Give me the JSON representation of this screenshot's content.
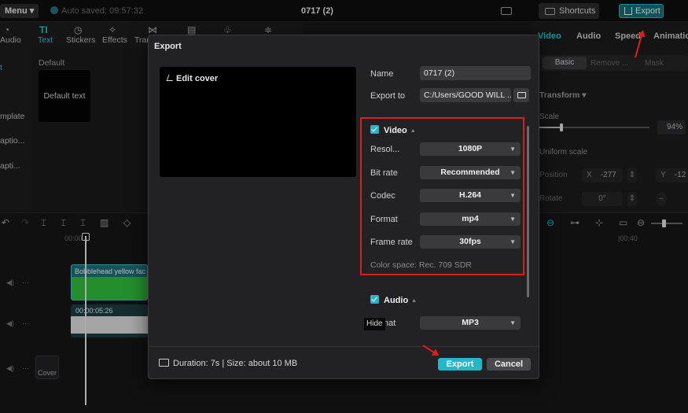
{
  "topbar": {
    "menu_label": "Menu",
    "autosave_text": "Auto saved: 09:57:32",
    "project_title": "0717 (2)",
    "shortcuts_label": "Shortcuts",
    "export_label": "Export"
  },
  "media_tabs": [
    {
      "label": "Audio"
    },
    {
      "label": "Text"
    },
    {
      "label": "Stickers"
    },
    {
      "label": "Effects"
    },
    {
      "label": "Tran"
    }
  ],
  "left_nav": [
    {
      "label": "t"
    },
    {
      "label": "mplate"
    },
    {
      "label": "aptio..."
    },
    {
      "label": "apti..."
    }
  ],
  "media_panel": {
    "section_label": "Default",
    "card_label": "Default text"
  },
  "right_panel": {
    "tabs": [
      {
        "label": "Video"
      },
      {
        "label": "Audio"
      },
      {
        "label": "Speed"
      },
      {
        "label": "Animatio"
      }
    ],
    "subtabs": [
      {
        "label": "Basic"
      },
      {
        "label": "Remove ..."
      },
      {
        "label": "Mask"
      }
    ],
    "transform_label": "Transform",
    "scale_label": "Scale",
    "scale_fraction": 0.2,
    "scale_value": "94%",
    "uniform_scale_label": "Uniform scale",
    "position_label": "Position",
    "pos_x_label": "X",
    "pos_x_value": "-277",
    "pos_y_label": "Y",
    "pos_y_value": "-12",
    "rotate_label": "Rotate",
    "rotate_value": "0°"
  },
  "timeline": {
    "ruler_labels": [
      "00:00",
      "|00:40"
    ],
    "video_clip_title": "Bobblehead yellow fac",
    "audio_clip_time": "00:00:05:26",
    "cover_label": "Cover"
  },
  "dialog": {
    "title": "Export",
    "edit_cover_label": "Edit cover",
    "name_label": "Name",
    "name_value": "0717 (2)",
    "export_to_label": "Export to",
    "export_to_value": "C:/Users/GOOD WILL ...",
    "video_section_label": "Video",
    "video_settings": [
      {
        "label": "Resol...",
        "value": "1080P"
      },
      {
        "label": "Bit rate",
        "value": "Recommended"
      },
      {
        "label": "Codec",
        "value": "H.264"
      },
      {
        "label": "Format",
        "value": "mp4"
      },
      {
        "label": "Frame rate",
        "value": "30fps"
      }
    ],
    "color_space": "Color space: Rec. 709 SDR",
    "audio_section_label": "Audio",
    "hide_tooltip": "Hide",
    "audio_format_label_partial": "nat",
    "audio_format_value": "MP3",
    "duration_text": "Duration: 7s | Size: about 10 MB",
    "export_button": "Export",
    "cancel_button": "Cancel"
  },
  "colors": {
    "accent": "#21b9c8",
    "highlight_box": "#d42020",
    "dialog_bg": "#222224"
  }
}
